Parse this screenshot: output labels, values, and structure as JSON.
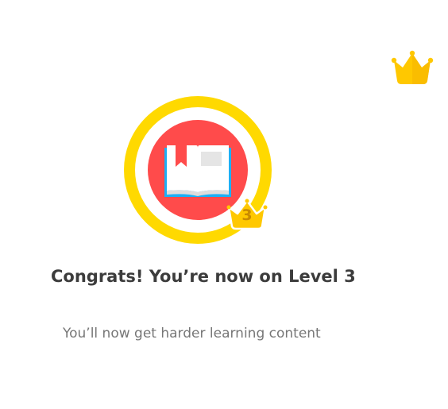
{
  "icons": {
    "top_crown": "crown-icon",
    "skill_icon": "open-book-icon",
    "level_crown": "crown-icon"
  },
  "colors": {
    "ring": "#ffd900",
    "skill_circle": "#ff4b4b",
    "crown": "#ffc800",
    "book_cover": "#1cb0f6",
    "title_text": "#3c3c3c",
    "subtitle_text": "#777777"
  },
  "badge": {
    "level_number": "3"
  },
  "message": {
    "title": "Congrats! You’re now on Level 3",
    "subtitle": "You’ll now get harder learning content"
  }
}
